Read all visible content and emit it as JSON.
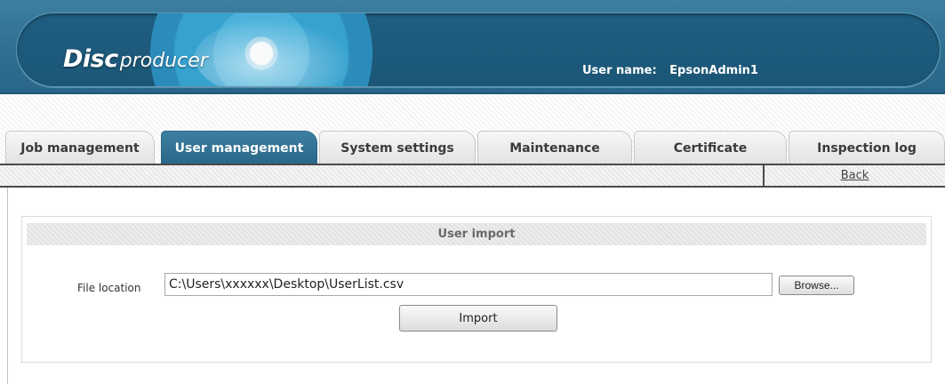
{
  "header": {
    "logo_part1": "Disc",
    "logo_part2": "producer",
    "user_label": "User name:",
    "user_value": "EpsonAdmin1"
  },
  "tabs": [
    {
      "label": "Job management",
      "active": false
    },
    {
      "label": "User management",
      "active": true
    },
    {
      "label": "System settings",
      "active": false
    },
    {
      "label": "Maintenance",
      "active": false
    },
    {
      "label": "Certificate",
      "active": false
    },
    {
      "label": "Inspection log",
      "active": false
    }
  ],
  "subbar": {
    "back_label": "Back"
  },
  "panel": {
    "title": "User import",
    "file_label": "File location",
    "file_value": "C:\\Users\\xxxxxx\\Desktop\\UserList.csv",
    "browse_label": "Browse...",
    "import_label": "Import"
  },
  "colors": {
    "header_blue": "#2f6f91",
    "active_tab": "#2a6688"
  }
}
